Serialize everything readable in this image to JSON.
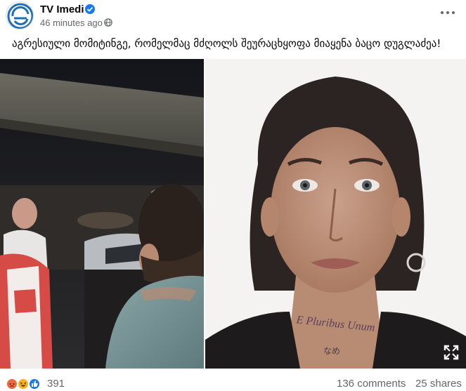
{
  "post": {
    "page_name": "TV Imedi",
    "timestamp": "46 minutes ago",
    "separator": "·",
    "caption": "აგრესიული მომიტინგე, რომელმაც მძღოლს შეურაცხყოფა მიაყენა ბაცო დუგლაძეა!",
    "image_right_tattoo": "E Pluribus Unum",
    "image_right_tattoo_2": "なめ",
    "icons": {
      "verified": "verified-badge-icon",
      "audience": "globe-icon",
      "more": "more-horizontal-icon",
      "expand": "expand-icon"
    },
    "colors": {
      "verified": "#1877f2",
      "secondary_text": "#65676b",
      "angry": "#f0683f",
      "haha": "#f7b125",
      "like": "#1877f2"
    }
  },
  "footer": {
    "reaction_count": "391",
    "reaction_types": [
      "angry",
      "haha",
      "like"
    ],
    "comments": "136 comments",
    "shares": "25 shares"
  }
}
